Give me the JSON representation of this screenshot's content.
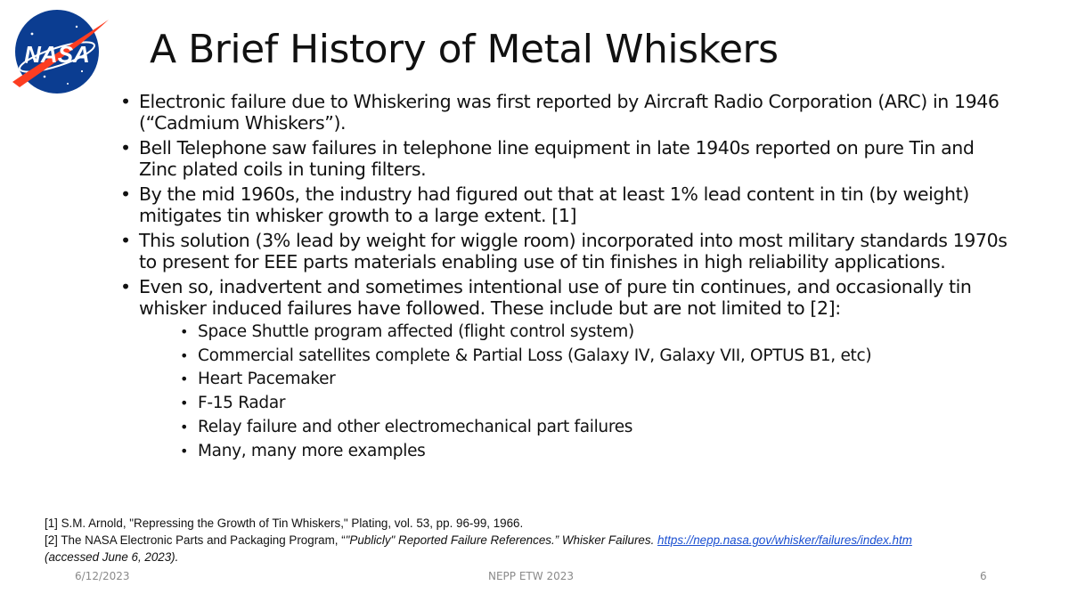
{
  "slide": {
    "logo_text": "NASA",
    "title": "A Brief History of Metal Whiskers",
    "bullets": [
      "Electronic failure due to Whiskering was first reported by Aircraft Radio Corporation (ARC) in 1946 (“Cadmium Whiskers”).",
      "Bell Telephone saw failures in telephone line equipment in late 1940s reported on pure Tin and Zinc plated coils in tuning filters.",
      "By the mid 1960s, the industry had figured out that at least 1% lead content in tin (by weight) mitigates tin whisker growth to a large extent. [1]",
      "This solution (3% lead by weight for wiggle room) incorporated into most military standards 1970s to present for EEE parts materials enabling use of tin finishes in high reliability applications.",
      "Even so, inadvertent and sometimes intentional use of pure tin continues, and occasionally tin whisker induced failures have followed.  These include but are not limited to [2]:"
    ],
    "sub_bullets": [
      "Space Shuttle program affected (flight control system)",
      "Commercial satellites complete & Partial Loss (Galaxy IV, Galaxy VII, OPTUS B1, etc)",
      "Heart Pacemaker",
      "F-15 Radar",
      "Relay failure and other electromechanical part failures",
      "Many, many more examples"
    ],
    "references": {
      "ref1": "[1]  S.M. Arnold, \"Repressing the Growth of Tin Whiskers,\" Plating, vol. 53, pp. 96-99, 1966.",
      "ref2_prefix": "[2] The NASA Electronic Parts and Packaging Program, “",
      "ref2_italic": "\"Publicly\" Reported Failure References.” Whisker Failures.",
      "ref2_link": "https://nepp.nasa.gov/whisker/failures/index.htm",
      "ref2_access": "(accessed June 6, 2023)."
    },
    "footer": {
      "date": "6/12/2023",
      "center": "NEPP ETW 2023",
      "page_number": "6"
    },
    "colors": {
      "nasa_blue": "#0b3d91",
      "nasa_red": "#fc3d21",
      "link": "#1a4fd1",
      "footer_gray": "#8a8a8a"
    }
  }
}
